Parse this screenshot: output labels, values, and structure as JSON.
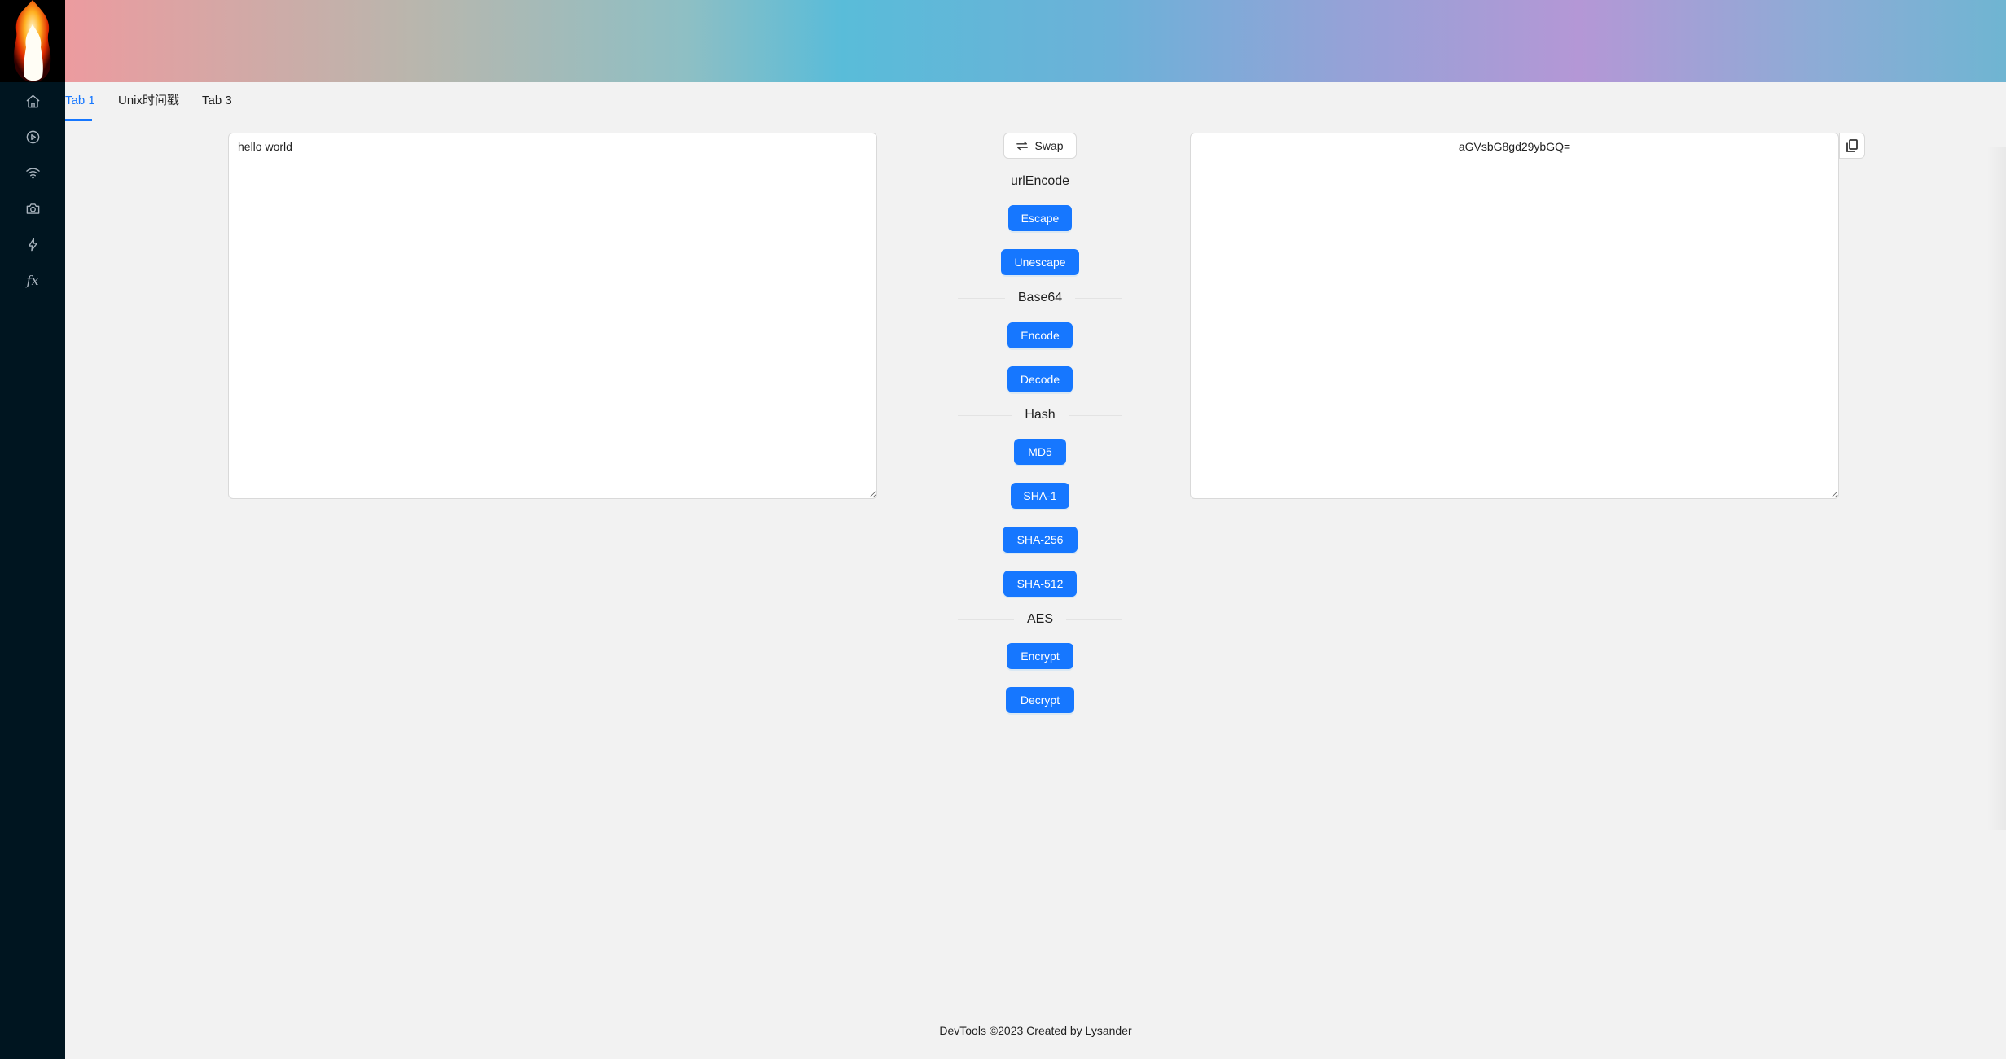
{
  "tabs": [
    {
      "label": "Tab 1",
      "active": true
    },
    {
      "label": "Unix时间戳",
      "active": false
    },
    {
      "label": "Tab 3",
      "active": false
    }
  ],
  "sidebar": {
    "items": [
      {
        "icon": "home-icon"
      },
      {
        "icon": "play-circle-icon"
      },
      {
        "icon": "wifi-icon"
      },
      {
        "icon": "camera-icon"
      },
      {
        "icon": "thunderbolt-icon"
      },
      {
        "icon": "function-icon",
        "label": "fx"
      }
    ]
  },
  "input": {
    "value": "hello world"
  },
  "output": {
    "value": "aGVsbG8gd29ybGQ="
  },
  "actions": {
    "swap_label": "Swap",
    "url_section": "urlEncode",
    "escape": "Escape",
    "unescape": "Unescape",
    "base64_section": "Base64",
    "encode": "Encode",
    "decode": "Decode",
    "hash_section": "Hash",
    "md5": "MD5",
    "sha1": "SHA-1",
    "sha256": "SHA-256",
    "sha512": "SHA-512",
    "aes_section": "AES",
    "encrypt": "Encrypt",
    "decrypt": "Decrypt"
  },
  "footer": "DevTools ©2023 Created by Lysander",
  "colors": {
    "primary": "#1677ff",
    "sidebar": "#001520",
    "background": "#f2f2f2"
  }
}
